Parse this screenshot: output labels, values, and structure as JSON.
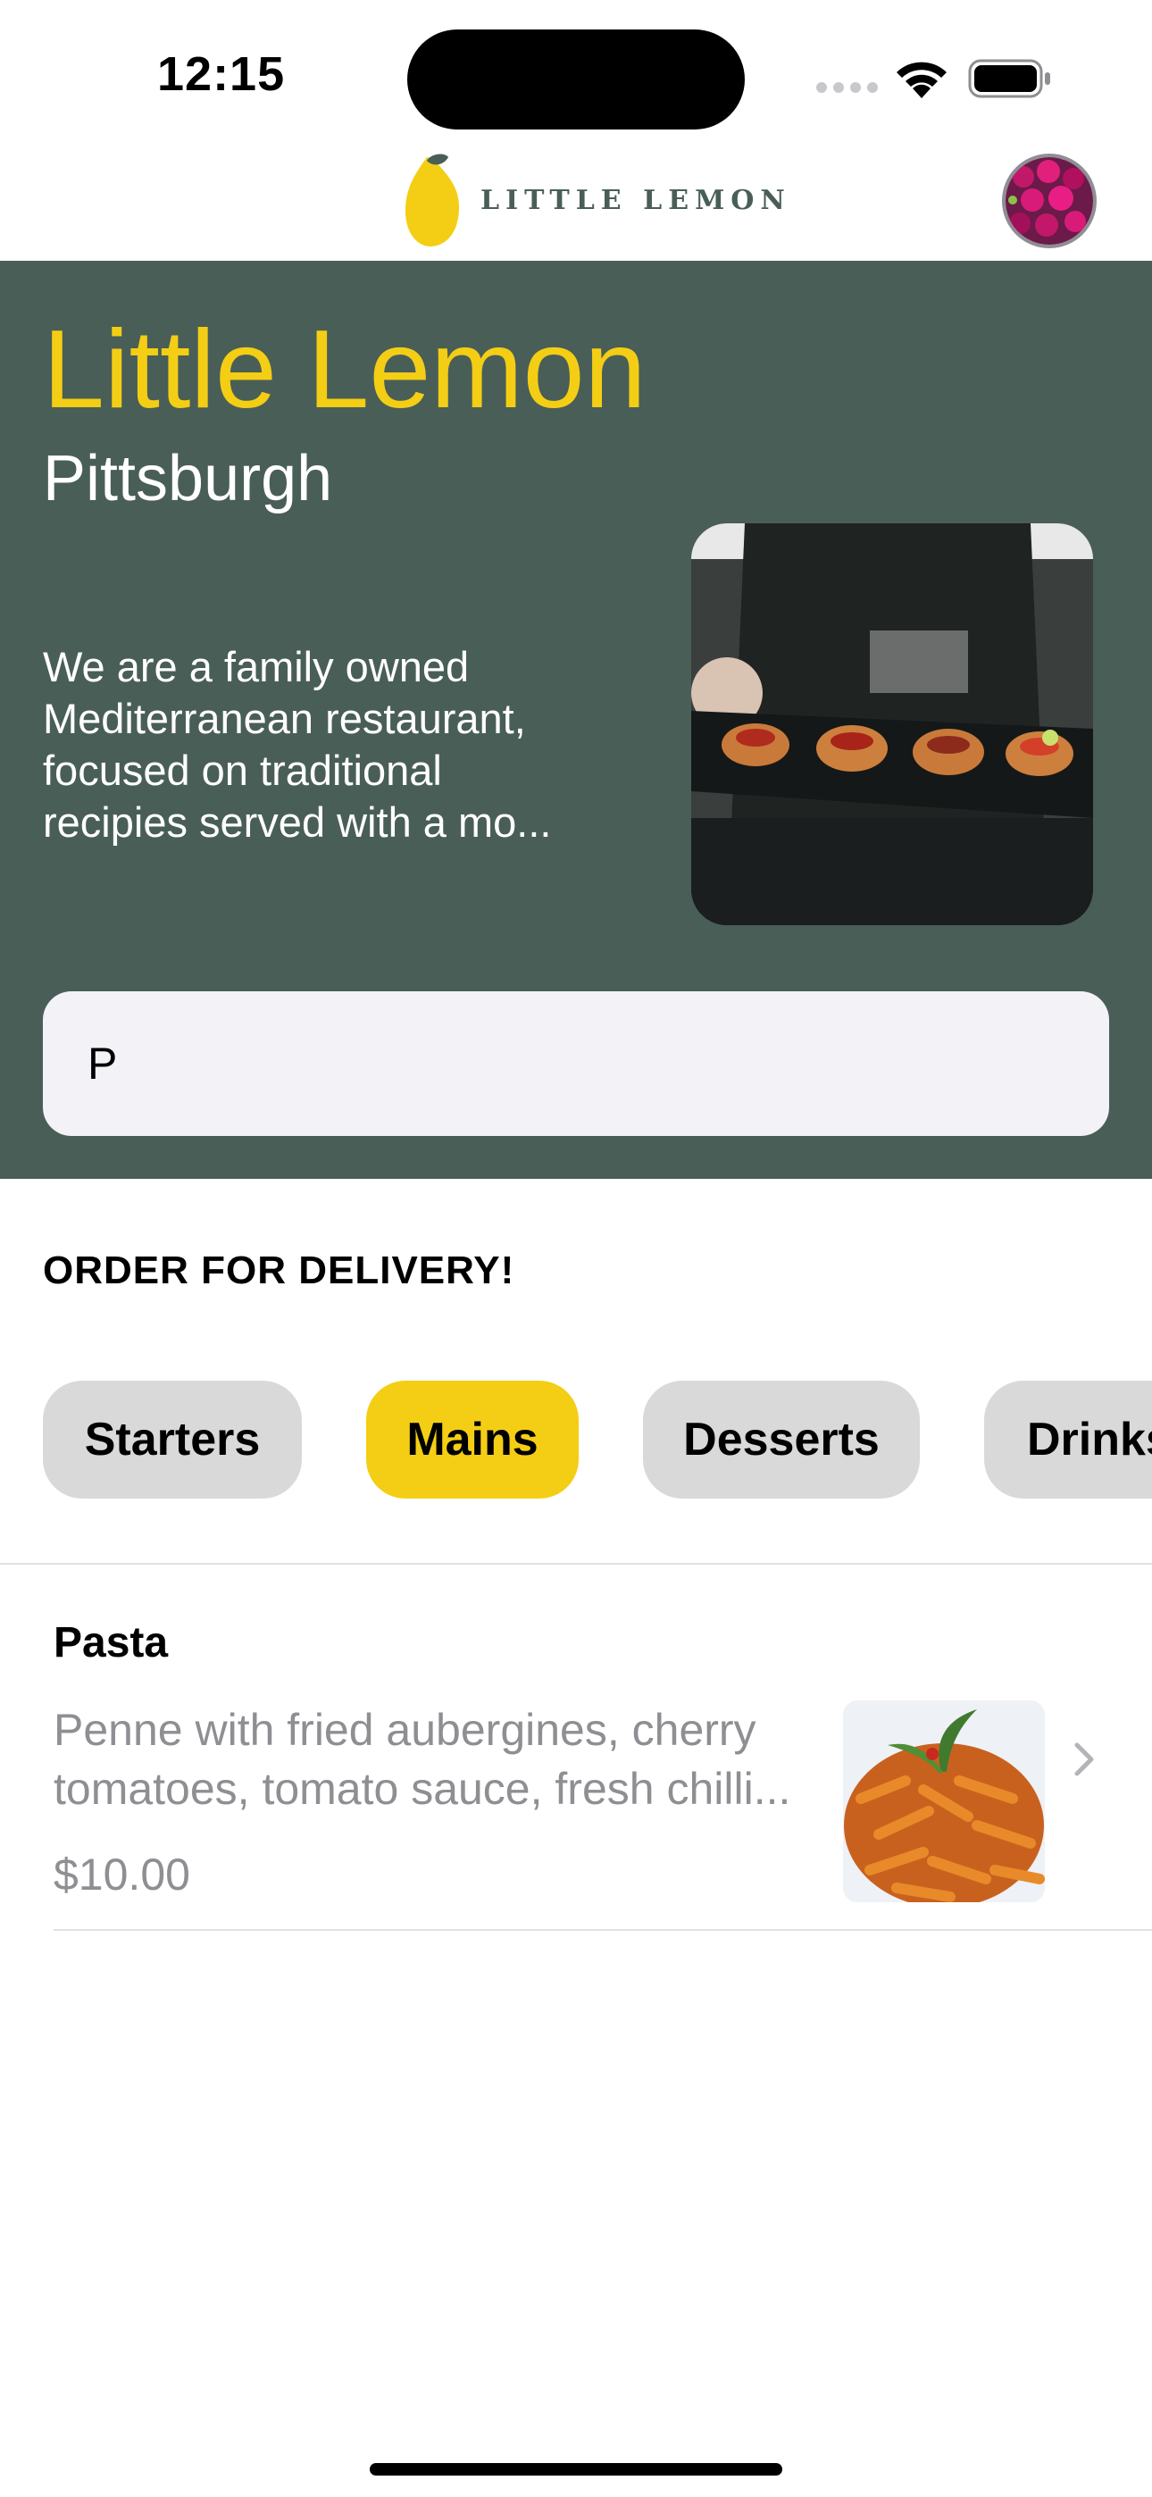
{
  "status_bar": {
    "time": "12:15"
  },
  "header": {
    "logo_text": "LITTLE LEMON"
  },
  "hero": {
    "title": "Little Lemon",
    "city": "Pittsburgh",
    "description_lines": [
      "We are a family owned",
      "Mediterranean restaurant,",
      "focused on traditional",
      "recipies served with a mo..."
    ],
    "search_value": "P"
  },
  "delivery": {
    "title": "ORDER FOR DELIVERY!",
    "categories": [
      {
        "label": "Starters",
        "selected": false
      },
      {
        "label": "Mains",
        "selected": true
      },
      {
        "label": "Desserts",
        "selected": false
      },
      {
        "label": "Drinks",
        "selected": false
      }
    ]
  },
  "menu_items": [
    {
      "name": "Pasta",
      "description_lines": [
        "Penne with fried aubergines, cherry",
        "tomatoes, tomato sauce, fresh chilli..."
      ],
      "price": "$10.00",
      "icon": "chevron-right-icon"
    }
  ],
  "colors": {
    "brand_green": "#495e57",
    "brand_yellow": "#f4ce14",
    "pill_gray": "#d9d9d9",
    "muted_text": "#8e8e93",
    "search_bg": "#f2f2f7"
  }
}
